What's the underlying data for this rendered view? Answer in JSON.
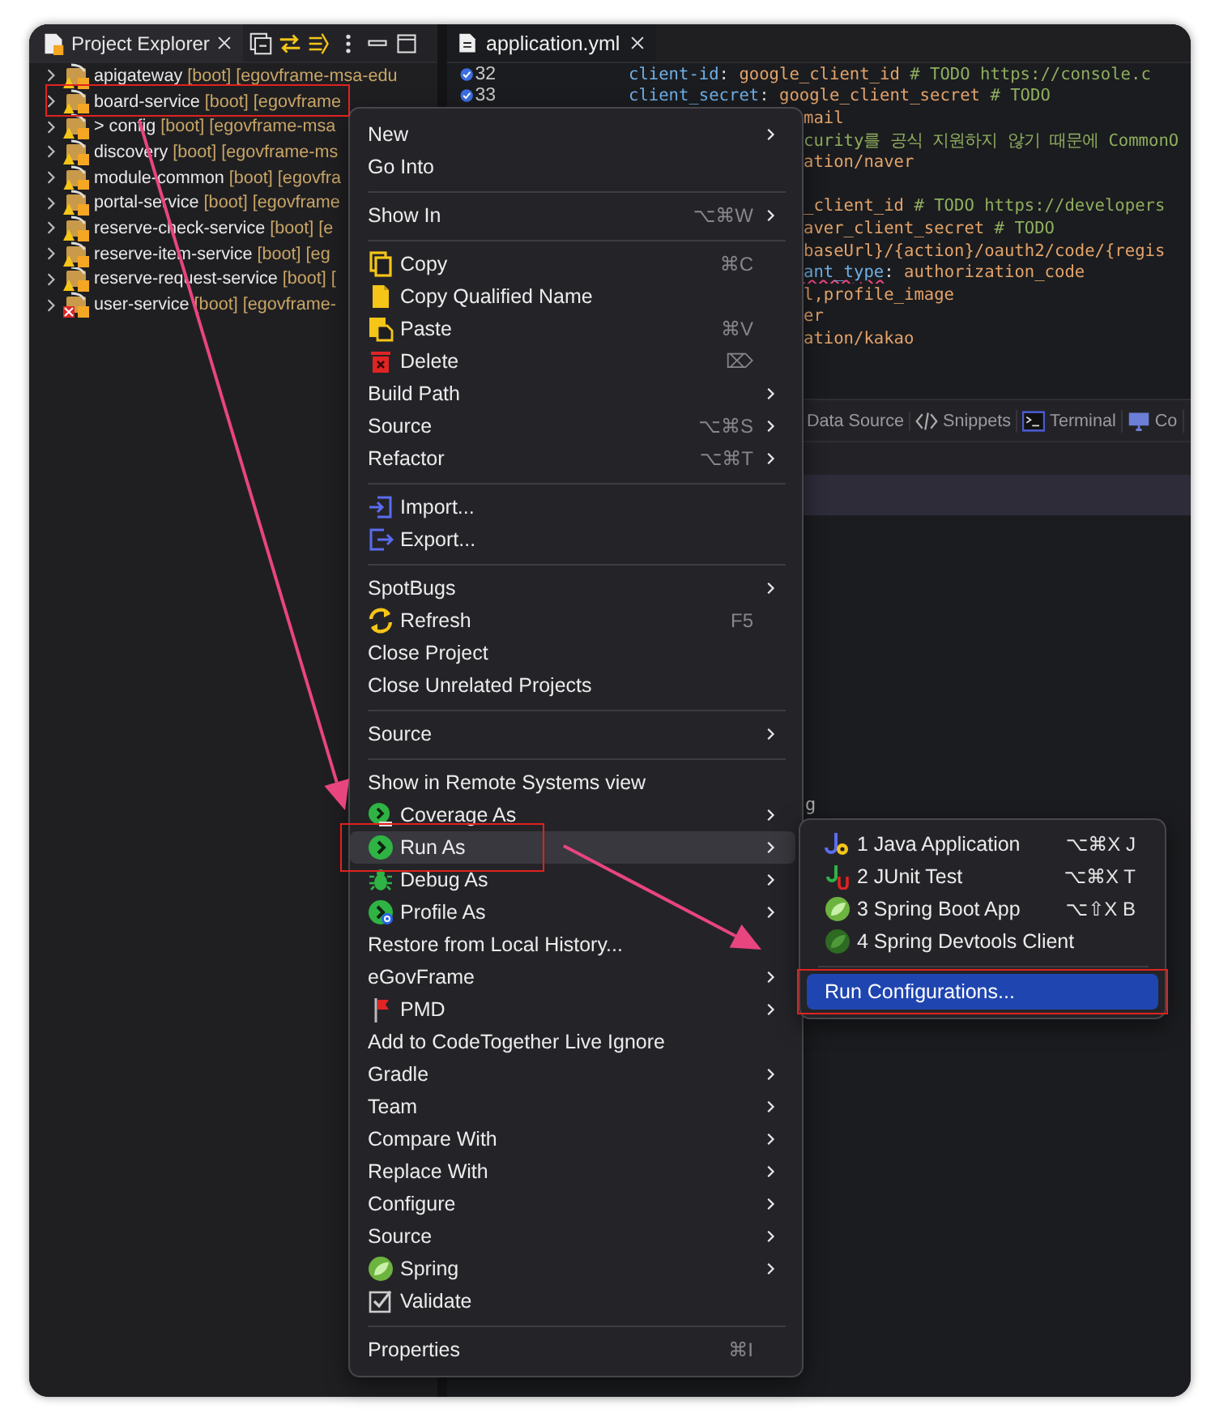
{
  "explorer": {
    "title": "Project Explorer",
    "projects": [
      {
        "name": "apigateway",
        "decoration": "[boot] [egovframe-msa-edu",
        "has_error": false,
        "annotated": false
      },
      {
        "name": "board-service",
        "decoration": "[boot] [egovframe",
        "has_error": false,
        "annotated": true
      },
      {
        "name": "> config",
        "decoration": "[boot] [egovframe-msa",
        "has_error": false,
        "annotated": false
      },
      {
        "name": "discovery",
        "decoration": "[boot] [egovframe-ms",
        "has_error": false,
        "annotated": false
      },
      {
        "name": "module-common",
        "decoration": "[boot] [egovfra",
        "has_error": false,
        "annotated": false
      },
      {
        "name": "portal-service",
        "decoration": "[boot] [egovframe",
        "has_error": false,
        "annotated": false
      },
      {
        "name": "reserve-check-service",
        "decoration": "[boot] [e",
        "has_error": false,
        "annotated": false
      },
      {
        "name": "reserve-item-service",
        "decoration": "[boot] [eg",
        "has_error": false,
        "annotated": false
      },
      {
        "name": "reserve-request-service",
        "decoration": "[boot] [",
        "has_error": false,
        "annotated": false
      },
      {
        "name": "user-service",
        "decoration": "[boot] [egovframe-",
        "has_error": true,
        "annotated": false
      }
    ]
  },
  "editor": {
    "tab": "application.yml",
    "lines": [
      {
        "kind": "full",
        "number": "32",
        "segments": [
          {
            "kind": "key",
            "text": "client-id"
          },
          {
            "kind": "plain",
            "text": ": "
          },
          {
            "kind": "value",
            "text": "google_client_id"
          },
          {
            "kind": "comment",
            "text": " # TODO https://console.c"
          }
        ]
      },
      {
        "kind": "full",
        "number": "33",
        "segments": [
          {
            "kind": "key",
            "text": "client_secret"
          },
          {
            "kind": "plain",
            "text": ": "
          },
          {
            "kind": "value",
            "text": "google_client_secret"
          },
          {
            "kind": "comment",
            "text": " # TODO"
          }
        ]
      },
      {
        "kind": "fragment",
        "segments": [
          {
            "kind": "value",
            "text": "mail"
          }
        ]
      },
      {
        "kind": "fragment",
        "segments": [
          {
            "kind": "comment",
            "text": "curity를 공식 지원하지 않기 때문에 CommonO"
          }
        ]
      },
      {
        "kind": "fragment",
        "segments": [
          {
            "kind": "value",
            "text": "ation/naver"
          }
        ]
      },
      {
        "kind": "blank"
      },
      {
        "kind": "fragment",
        "segments": [
          {
            "kind": "value",
            "text": "_client_id"
          },
          {
            "kind": "comment",
            "text": " # TODO https://developers"
          }
        ]
      },
      {
        "kind": "fragment",
        "segments": [
          {
            "kind": "value",
            "text": "aver_client_secret"
          },
          {
            "kind": "comment",
            "text": " # TODO"
          }
        ]
      },
      {
        "kind": "fragment",
        "segments": [
          {
            "kind": "value",
            "text": "baseUrl}/{action}/oauth2/code/{regis"
          }
        ]
      },
      {
        "kind": "fragment",
        "segments": [
          {
            "kind": "error_key",
            "text": "ant_type"
          },
          {
            "kind": "plain",
            "text": ": "
          },
          {
            "kind": "value",
            "text": "authorization_code"
          }
        ]
      },
      {
        "kind": "fragment",
        "segments": [
          {
            "kind": "value",
            "text": "l,profile_image"
          }
        ]
      },
      {
        "kind": "fragment",
        "segments": [
          {
            "kind": "value",
            "text": "er"
          }
        ]
      },
      {
        "kind": "fragment",
        "segments": [
          {
            "kind": "value",
            "text": "ation/kakao"
          }
        ]
      }
    ]
  },
  "panel": {
    "tabs": [
      {
        "label": "Data Source"
      },
      {
        "label": "Snippets"
      },
      {
        "label": "Terminal"
      },
      {
        "label": "Co"
      }
    ],
    "console": [
      "g"
    ]
  },
  "context_menu": {
    "items": [
      {
        "kind": "item",
        "label": "New",
        "submenu": true,
        "selected": false,
        "annotated": false
      },
      {
        "kind": "item",
        "label": "Go Into",
        "submenu": false,
        "selected": false,
        "annotated": false
      },
      {
        "kind": "separator"
      },
      {
        "kind": "item",
        "label": "Show In",
        "shortcut": "⌥⌘W",
        "submenu": true,
        "selected": false,
        "annotated": false
      },
      {
        "kind": "separator"
      },
      {
        "kind": "item",
        "label": "Copy",
        "shortcut": "⌘C",
        "submenu": false,
        "selected": false,
        "annotated": false
      },
      {
        "kind": "item",
        "label": "Copy Qualified Name",
        "submenu": false,
        "selected": false,
        "annotated": false
      },
      {
        "kind": "item",
        "label": "Paste",
        "shortcut": "⌘V",
        "submenu": false,
        "selected": false,
        "annotated": false
      },
      {
        "kind": "item",
        "label": "Delete",
        "shortcut": "⌦",
        "submenu": false,
        "selected": false,
        "annotated": false
      },
      {
        "kind": "item",
        "label": "Build Path",
        "submenu": true,
        "selected": false,
        "annotated": false
      },
      {
        "kind": "item",
        "label": "Source",
        "shortcut": "⌥⌘S",
        "submenu": true,
        "selected": false,
        "annotated": false
      },
      {
        "kind": "item",
        "label": "Refactor",
        "shortcut": "⌥⌘T",
        "submenu": true,
        "selected": false,
        "annotated": false
      },
      {
        "kind": "separator"
      },
      {
        "kind": "item",
        "label": "Import...",
        "submenu": false,
        "selected": false,
        "annotated": false
      },
      {
        "kind": "item",
        "label": "Export...",
        "submenu": false,
        "selected": false,
        "annotated": false
      },
      {
        "kind": "separator"
      },
      {
        "kind": "item",
        "label": "SpotBugs",
        "submenu": true,
        "selected": false,
        "annotated": false
      },
      {
        "kind": "item",
        "label": "Refresh",
        "shortcut": "F5",
        "submenu": false,
        "selected": false,
        "annotated": false
      },
      {
        "kind": "item",
        "label": "Close Project",
        "submenu": false,
        "selected": false,
        "annotated": false
      },
      {
        "kind": "item",
        "label": "Close Unrelated Projects",
        "submenu": false,
        "selected": false,
        "annotated": false
      },
      {
        "kind": "separator"
      },
      {
        "kind": "item",
        "label": "Source",
        "submenu": true,
        "selected": false,
        "annotated": false
      },
      {
        "kind": "separator"
      },
      {
        "kind": "item",
        "label": "Show in Remote Systems view",
        "submenu": false,
        "selected": false,
        "annotated": false
      },
      {
        "kind": "item",
        "label": "Coverage As",
        "submenu": true,
        "selected": false,
        "annotated": false
      },
      {
        "kind": "item",
        "label": "Run As",
        "submenu": true,
        "selected": true,
        "annotated": true
      },
      {
        "kind": "item",
        "label": "Debug As",
        "submenu": true,
        "selected": false,
        "annotated": false
      },
      {
        "kind": "item",
        "label": "Profile As",
        "submenu": true,
        "selected": false,
        "annotated": false
      },
      {
        "kind": "item",
        "label": "Restore from Local History...",
        "submenu": false,
        "selected": false,
        "annotated": false
      },
      {
        "kind": "item",
        "label": "eGovFrame",
        "submenu": true,
        "selected": false,
        "annotated": false
      },
      {
        "kind": "item",
        "label": "PMD",
        "submenu": true,
        "selected": false,
        "annotated": false
      },
      {
        "kind": "item",
        "label": "Add to CodeTogether Live Ignore",
        "submenu": false,
        "selected": false,
        "annotated": false
      },
      {
        "kind": "item",
        "label": "Gradle",
        "submenu": true,
        "selected": false,
        "annotated": false
      },
      {
        "kind": "item",
        "label": "Team",
        "submenu": true,
        "selected": false,
        "annotated": false
      },
      {
        "kind": "item",
        "label": "Compare With",
        "submenu": true,
        "selected": false,
        "annotated": false
      },
      {
        "kind": "item",
        "label": "Replace With",
        "submenu": true,
        "selected": false,
        "annotated": false
      },
      {
        "kind": "item",
        "label": "Configure",
        "submenu": true,
        "selected": false,
        "annotated": false
      },
      {
        "kind": "item",
        "label": "Source",
        "submenu": true,
        "selected": false,
        "annotated": false
      },
      {
        "kind": "item",
        "label": "Spring",
        "submenu": true,
        "selected": false,
        "annotated": false
      },
      {
        "kind": "item",
        "label": "Validate",
        "submenu": false,
        "selected": false,
        "annotated": false
      },
      {
        "kind": "separator"
      },
      {
        "kind": "item",
        "label": "Properties",
        "shortcut": "⌘I",
        "submenu": false,
        "selected": false,
        "annotated": false
      }
    ]
  },
  "submenu": {
    "items": [
      {
        "kind": "item",
        "label": "1 Java Application",
        "shortcut": "⌥⌘X J",
        "selected": false,
        "annotated": false
      },
      {
        "kind": "item",
        "label": "2 JUnit Test",
        "shortcut": "⌥⌘X T",
        "selected": false,
        "annotated": false
      },
      {
        "kind": "item",
        "label": "3 Spring Boot App",
        "shortcut": "⌥⇧X B",
        "selected": false,
        "annotated": false
      },
      {
        "kind": "item",
        "label": "4 Spring Devtools Client",
        "selected": false,
        "annotated": false
      },
      {
        "kind": "separator"
      },
      {
        "kind": "item",
        "label": "Run Configurations...",
        "selected": true,
        "annotated": true
      }
    ]
  }
}
